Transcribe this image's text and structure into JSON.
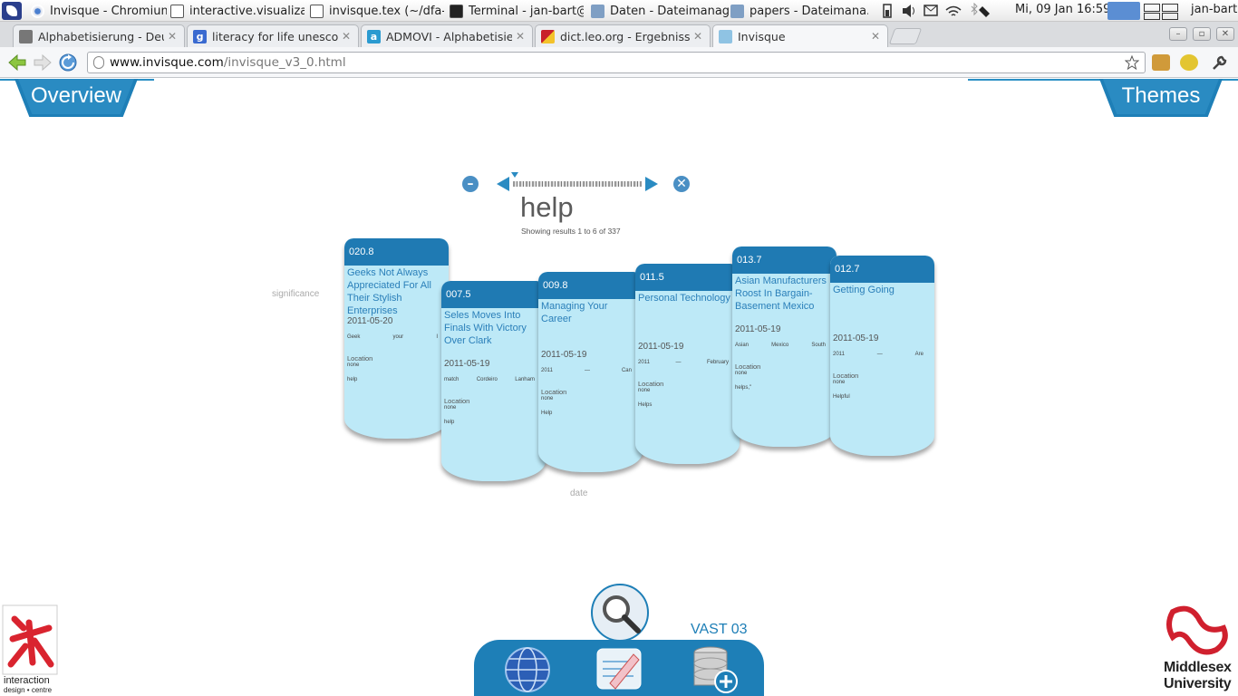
{
  "os_panel": {
    "tasks": [
      {
        "label": "Invisque - Chromium",
        "icon": "chromium-icon",
        "active": false
      },
      {
        "label": "interactive.visualiza...",
        "icon": "document-icon",
        "active": false
      },
      {
        "label": "invisque.tex (~/dfa-...",
        "icon": "text-editor-icon",
        "active": false
      },
      {
        "label": "Terminal - jan-bart@...",
        "icon": "terminal-icon",
        "active": false
      },
      {
        "label": "Daten - Dateimanager",
        "icon": "folder-icon",
        "active": false
      },
      {
        "label": "papers - Dateimana...",
        "icon": "folder-icon",
        "active": false
      }
    ],
    "clock": "Mi, 09 Jan 16:59",
    "user": "jan-bart"
  },
  "browser": {
    "tabs": [
      {
        "label": "Alphabetisierung - Deutsch",
        "favicon": "museum-icon"
      },
      {
        "label": "literacy for life unesco - Go",
        "favicon": "google-icon"
      },
      {
        "label": "ADMOVI - Alphabetisierung",
        "favicon": "admovi-icon"
      },
      {
        "label": "dict.leo.org - Ergebnisse für",
        "favicon": "leo-icon"
      },
      {
        "label": "Invisque",
        "favicon": "invisque-icon"
      }
    ],
    "url_host": "www.invisque.com",
    "url_path": "/invisque_v3_0.html"
  },
  "app": {
    "overview_label": "Overview",
    "themes_label": "Themes",
    "query": "help",
    "results_info": "Showing results 1 to 6 of 337",
    "axis_y": "significance",
    "axis_x": "date",
    "vast_label": "VAST 03",
    "logo_left_line1": "interaction",
    "logo_left_line2": "design • centre",
    "logo_right_line1": "Middlesex",
    "logo_right_line2": "University"
  },
  "cards": [
    {
      "score": "020.8",
      "title": "Geeks Not Always Appreciated For All Their Stylish Enterprises",
      "date": "2011-05-20",
      "snippet": [
        "Geek",
        "your",
        "I"
      ],
      "location_label": "Location",
      "location_value": "none",
      "keyword": "help"
    },
    {
      "score": "007.5",
      "title": "Seles Moves Into Finals With Victory Over Clark",
      "date": "2011-05-19",
      "snippet": [
        "match",
        "Cordeiro",
        "Lanham"
      ],
      "location_label": "Location",
      "location_value": "none",
      "keyword": "help"
    },
    {
      "score": "009.8",
      "title": "Managing Your Career",
      "date": "2011-05-19",
      "snippet": [
        "2011",
        "—",
        "Can"
      ],
      "location_label": "Location",
      "location_value": "none",
      "keyword": "Help"
    },
    {
      "score": "011.5",
      "title": "Personal Technology",
      "date": "2011-05-19",
      "snippet": [
        "2011",
        "—",
        "February"
      ],
      "location_label": "Location",
      "location_value": "none",
      "keyword": "Helps"
    },
    {
      "score": "013.7",
      "title": "Asian Manufacturers Roost In Bargain-Basement Mexico",
      "date": "2011-05-19",
      "snippet": [
        "Asian",
        "Mexico",
        "South"
      ],
      "location_label": "Location",
      "location_value": "none",
      "keyword": "helps,\""
    },
    {
      "score": "012.7",
      "title": "Getting Going",
      "date": "2011-05-19",
      "snippet": [
        "2011",
        "—",
        "Are"
      ],
      "location_label": "Location",
      "location_value": "none",
      "keyword": "Helpful"
    }
  ],
  "colors": {
    "accent": "#1f7ab3",
    "card_fill": "#bde9f7",
    "card_title": "#2a7fb9"
  }
}
